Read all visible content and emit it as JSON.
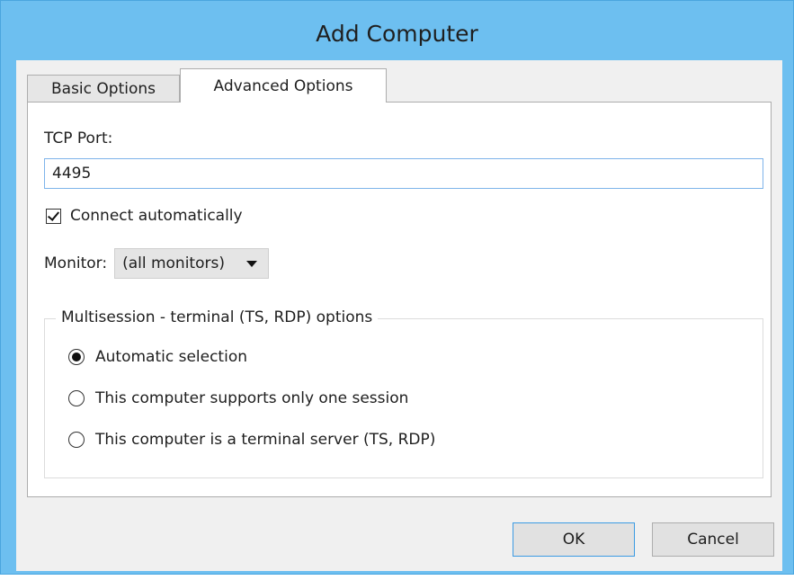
{
  "window": {
    "title": "Add Computer"
  },
  "tabs": [
    {
      "label": "Basic Options",
      "selected": false
    },
    {
      "label": "Advanced Options",
      "selected": true
    }
  ],
  "advanced": {
    "tcp_port_label": "TCP Port:",
    "tcp_port_value": "4495",
    "connect_auto_label": "Connect automatically",
    "connect_auto_checked": true,
    "monitor_label": "Monitor:",
    "monitor_value": "(all monitors)",
    "multisession": {
      "legend": "Multisession - terminal (TS, RDP) options",
      "options": [
        {
          "label": "Automatic selection",
          "selected": true
        },
        {
          "label": "This computer supports only one session",
          "selected": false
        },
        {
          "label": "This computer is a terminal server (TS, RDP)",
          "selected": false
        }
      ]
    }
  },
  "buttons": {
    "ok": "OK",
    "cancel": "Cancel"
  },
  "colors": {
    "titlebar": "#6dbff0",
    "input_border": "#7eb4ea",
    "ok_border": "#3c9be3"
  },
  "icons": {
    "check": "checkmark-icon",
    "dropdown": "chevron-down-icon"
  }
}
